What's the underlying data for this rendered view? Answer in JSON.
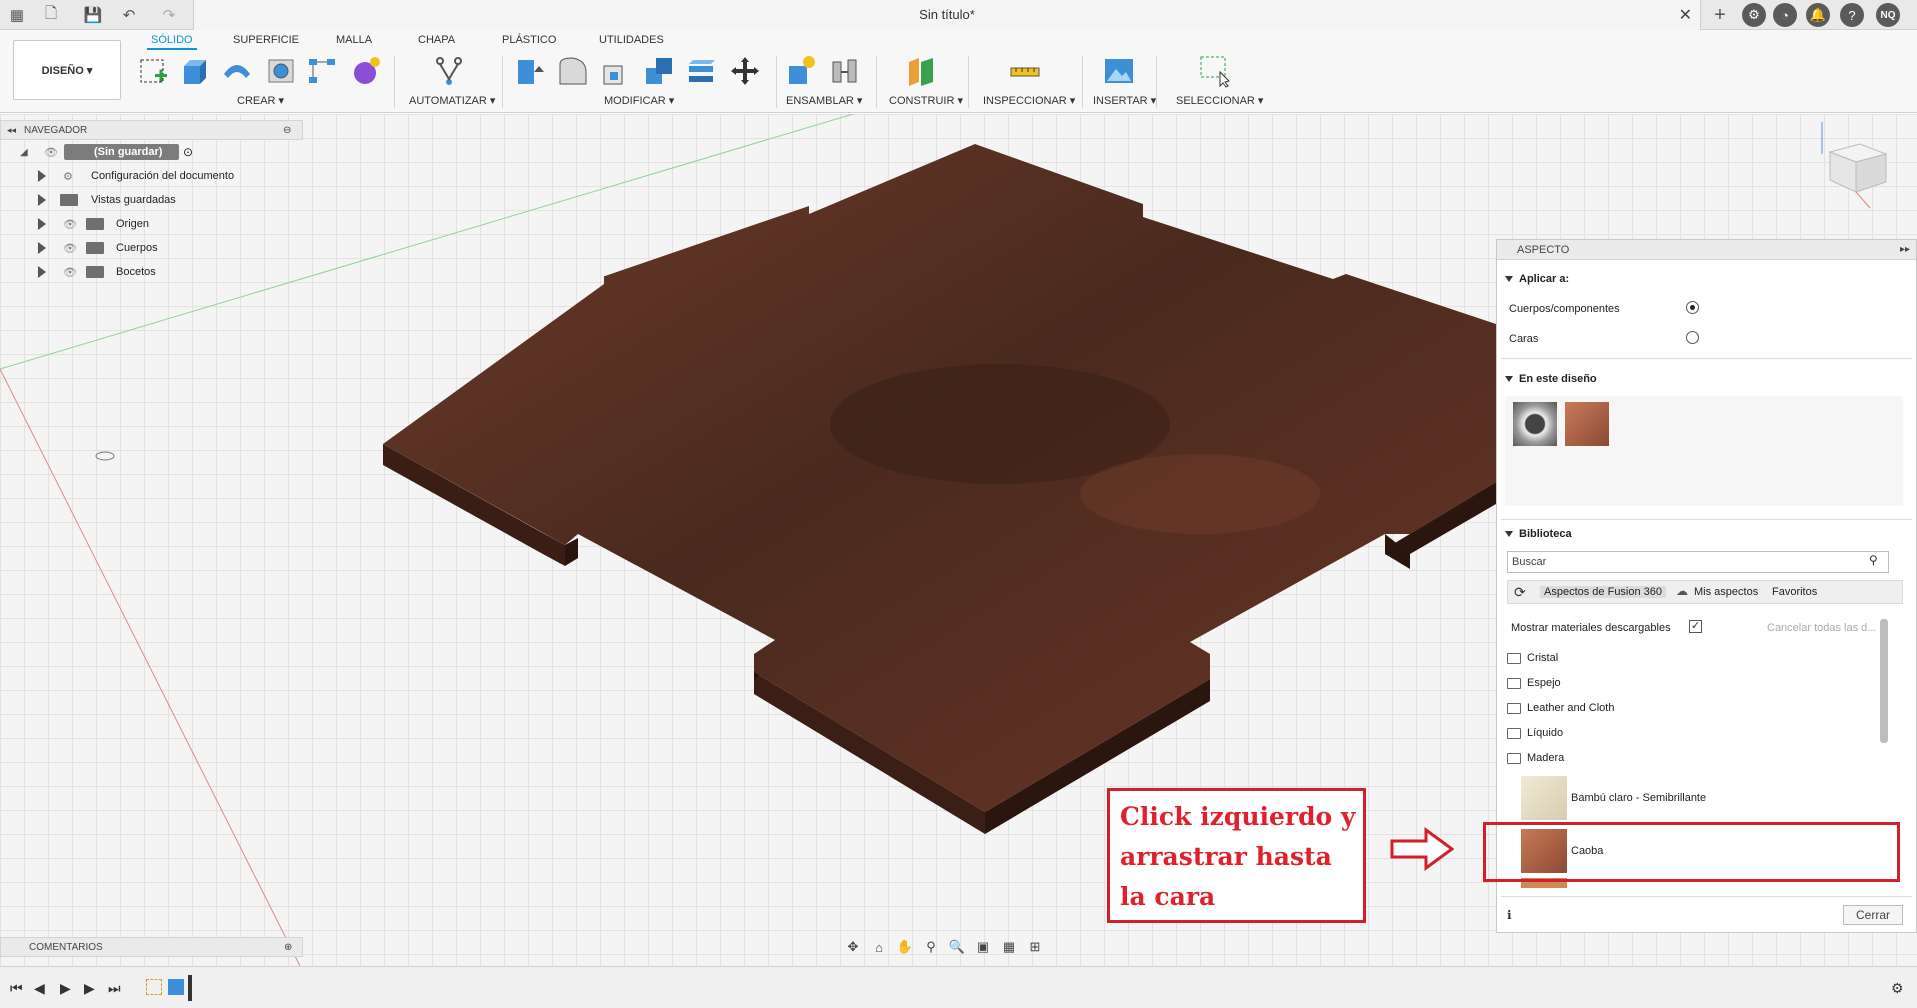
{
  "titlebar": {
    "doc_title": "Sin título*",
    "user_initials": "NQ"
  },
  "ribbon": {
    "workspace": "DISEÑO ▾",
    "tabs": [
      "SÓLIDO",
      "SUPERFICIE",
      "MALLA",
      "CHAPA",
      "PLÁSTICO",
      "UTILIDADES"
    ],
    "active_tab": "SÓLIDO",
    "groups": [
      "CREAR ▾",
      "AUTOMATIZAR ▾",
      "MODIFICAR ▾",
      "ENSAMBLAR ▾",
      "CONSTRUIR ▾",
      "INSPECCIONAR ▾",
      "INSERTAR ▾",
      "SELECCIONAR ▾"
    ]
  },
  "navigator": {
    "title": "NAVEGADOR",
    "root": "(Sin guardar)",
    "items": [
      {
        "label": "Configuración del documento",
        "icon": "gear-icon"
      },
      {
        "label": "Vistas guardadas",
        "icon": "folder-icon"
      },
      {
        "label": "Origen",
        "icon": "folder-icon"
      },
      {
        "label": "Cuerpos",
        "icon": "folder-icon"
      },
      {
        "label": "Bocetos",
        "icon": "folder-icon"
      }
    ]
  },
  "comments": {
    "title": "COMENTARIOS"
  },
  "aspect": {
    "title": "ASPECTO",
    "apply_title": "Aplicar a:",
    "apply_options": [
      {
        "label": "Cuerpos/componentes",
        "selected": true
      },
      {
        "label": "Caras",
        "selected": false
      }
    ],
    "in_design_title": "En este diseño",
    "library_title": "Biblioteca",
    "search_placeholder": "Buscar",
    "tabs": [
      "Aspectos de Fusion 360",
      "Mis aspectos",
      "Favoritos"
    ],
    "show_downloadable": "Mostrar materiales descargables",
    "cancel_downloads": "Cancelar todas las d...",
    "folders": [
      "Cristal",
      "Espejo",
      "Leather and Cloth",
      "Líquido",
      "Madera"
    ],
    "materials": [
      "Bambú claro - Semibrillante",
      "Caoba"
    ],
    "close": "Cerrar"
  },
  "annotation": {
    "text": "Click izquierdo y arrastrar hasta la cara",
    "color": "#e0202c"
  },
  "colors": {
    "accent": "#0696d7",
    "wood": "#5a2e22",
    "annotation": "#d0202c"
  }
}
